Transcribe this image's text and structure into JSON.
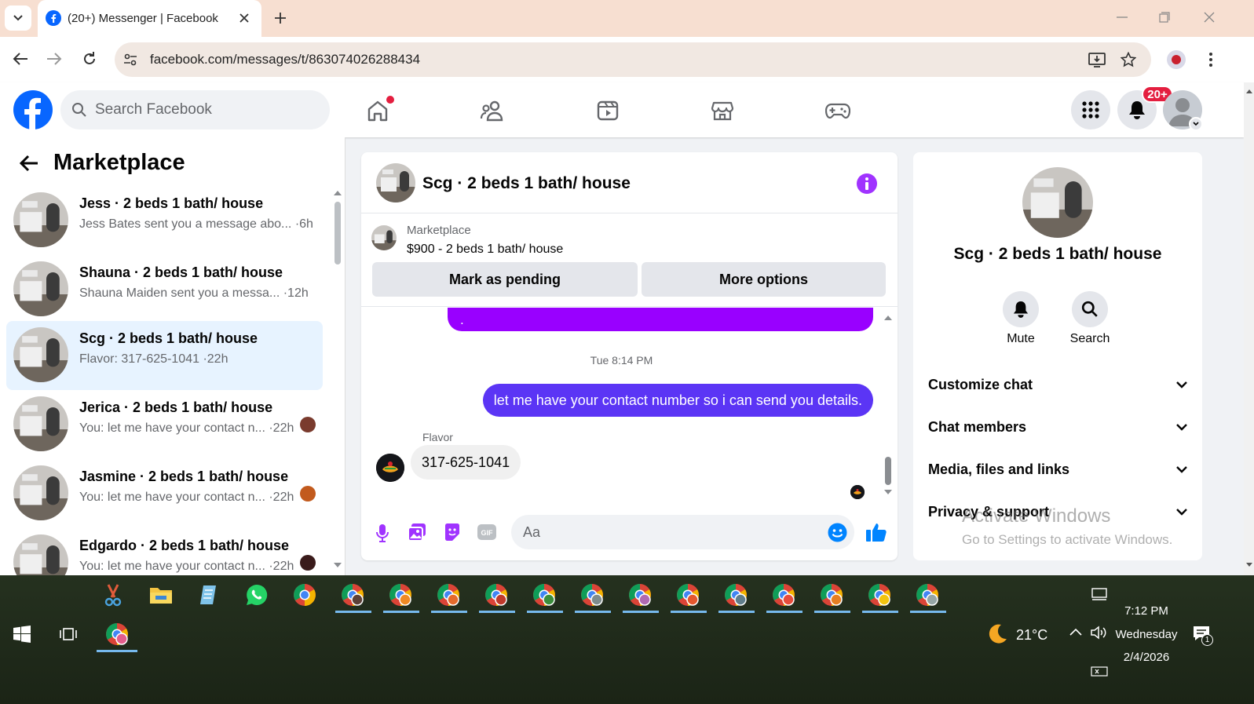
{
  "browser": {
    "tab_title": "(20+) Messenger | Facebook",
    "url": "facebook.com/messages/t/863074026288434"
  },
  "fb": {
    "search_placeholder": "Search Facebook",
    "notif_badge": "20+"
  },
  "left": {
    "title": "Marketplace",
    "conversations": [
      {
        "title": "Jess · 2 beds 1 bath/ house",
        "preview": "Jess Bates sent you a message abo...",
        "time": "·6h",
        "selected": false
      },
      {
        "title": "Shauna · 2 beds 1 bath/ house",
        "preview": "Shauna Maiden sent you a messa...",
        "time": "·12h",
        "selected": false
      },
      {
        "title": "Scg · 2 beds 1 bath/ house",
        "preview": "Flavor: 317-625-1041",
        "time": "·22h",
        "selected": true
      },
      {
        "title": "Jerica · 2 beds 1 bath/ house",
        "preview": "You: let me have your contact n...",
        "time": "·22h",
        "selected": false
      },
      {
        "title": "Jasmine · 2 beds 1 bath/ house",
        "preview": "You: let me have your contact n...",
        "time": "·22h",
        "selected": false
      },
      {
        "title": "Edgardo · 2 beds 1 bath/ house",
        "preview": "You: let me have your contact n...",
        "time": "·22h",
        "selected": false
      }
    ]
  },
  "chat": {
    "title": "Scg · 2 beds 1 bath/ house",
    "listing_source": "Marketplace",
    "listing_desc": "$900 - 2 beds 1 bath/ house",
    "mark_pending": "Mark as pending",
    "more_options": "More options",
    "partial_bubble": ".",
    "timestamp": "Tue 8:14 PM",
    "sent_message": "let me have your contact number so i can send you details.",
    "sender_name": "Flavor",
    "received_message": "317-625-1041",
    "input_placeholder": "Aa",
    "colors": {
      "accent": "#a033ff",
      "sent_bubble": "#5b35f5",
      "partial_bubble": "#9900ff"
    }
  },
  "right": {
    "title": "Scg · 2 beds 1 bath/ house",
    "mute_label": "Mute",
    "search_label": "Search",
    "options": [
      "Customize chat",
      "Chat members",
      "Media, files and links",
      "Privacy & support"
    ],
    "watermark_line1": "Activate Windows",
    "watermark_line2": "Go to Settings to activate Windows."
  },
  "taskbar": {
    "weather_temp": "21°C",
    "time": "7:12 PM",
    "day": "Wednesday",
    "date": "2/4/2026",
    "notif_count": "1"
  }
}
